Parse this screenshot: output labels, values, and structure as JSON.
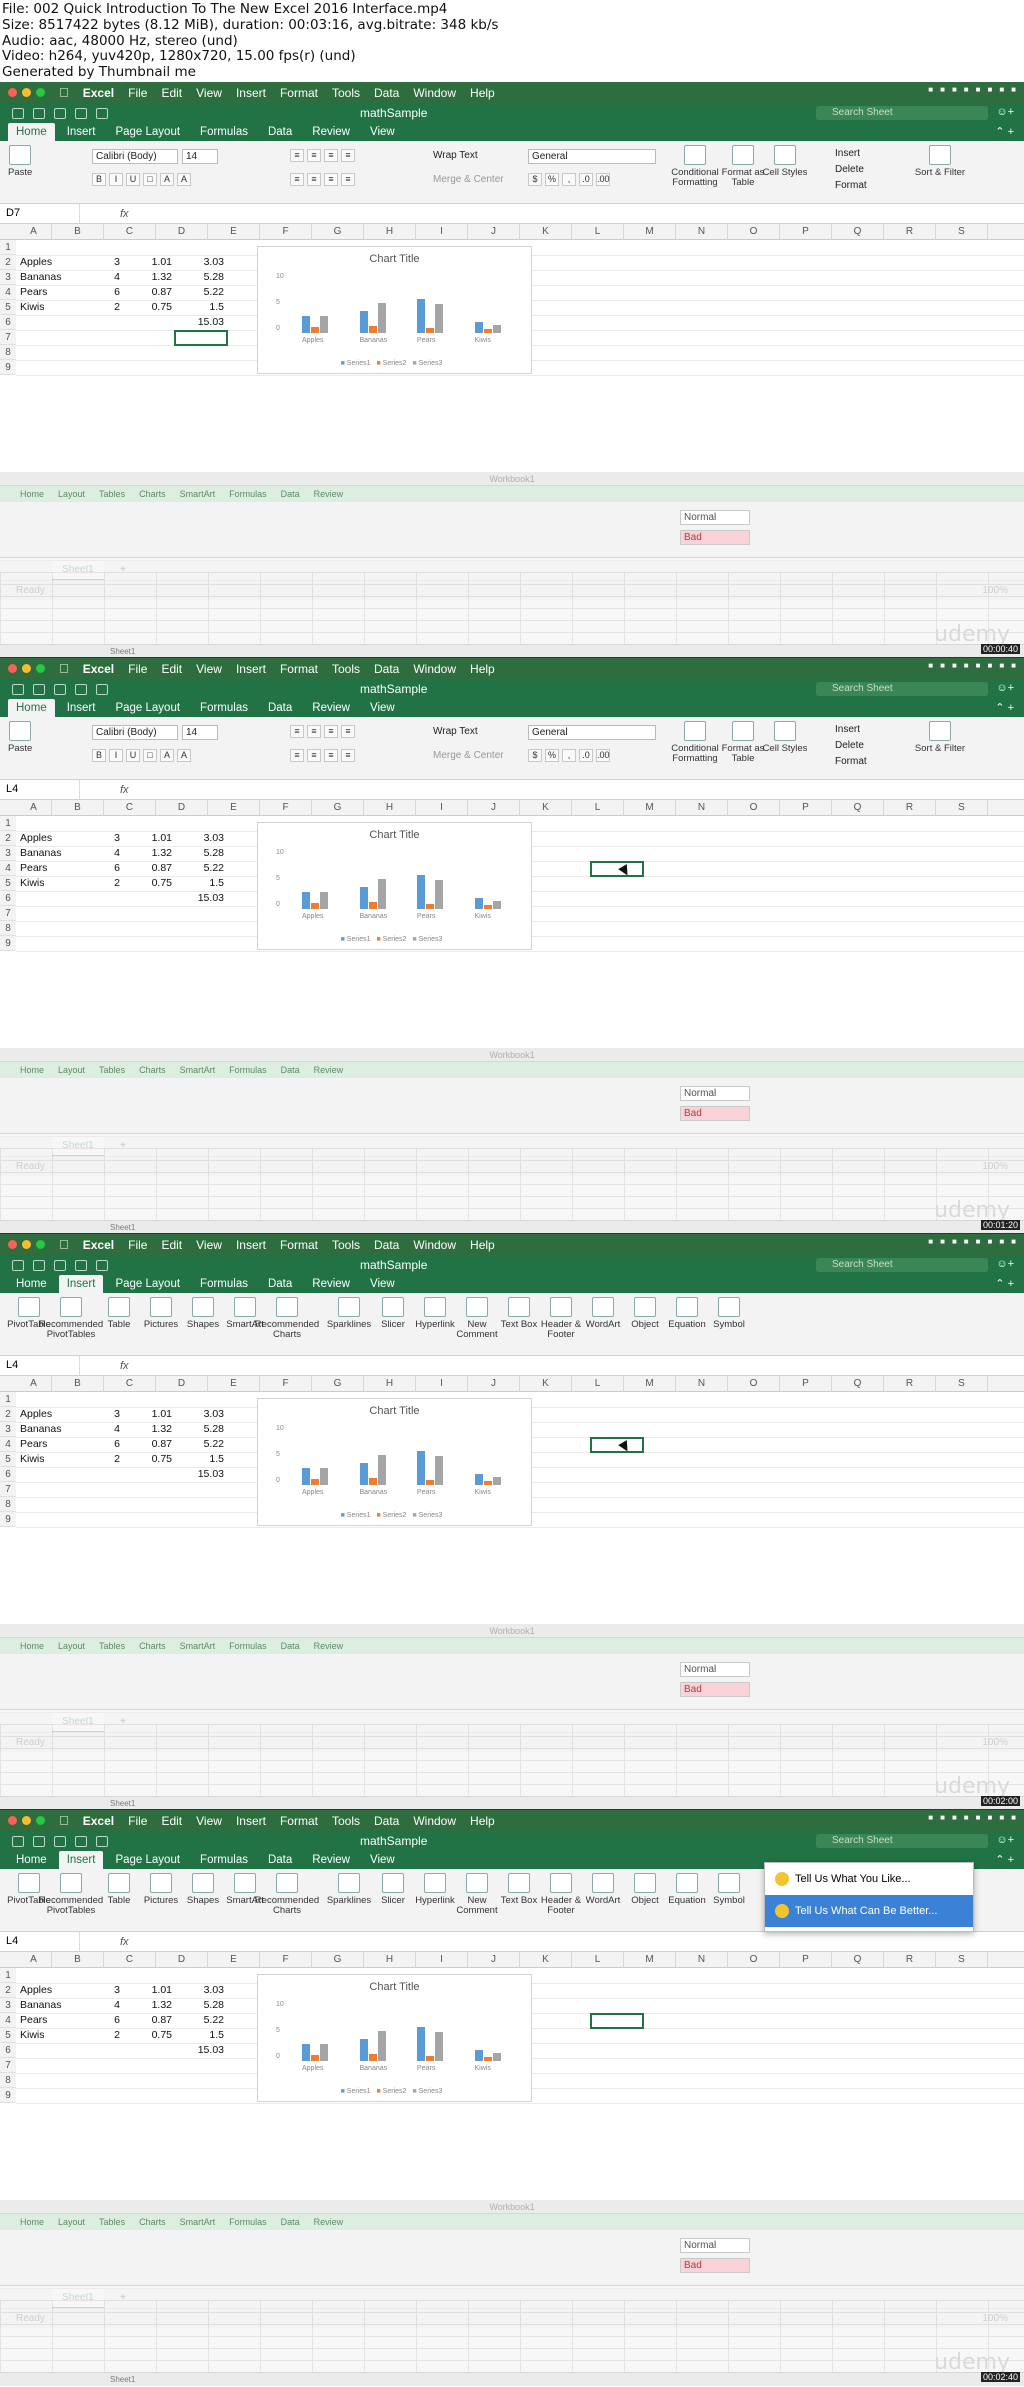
{
  "header": {
    "lines": [
      "File: 002 Quick Introduction To The New Excel 2016 Interface.mp4",
      "Size: 8517422 bytes (8.12 MiB), duration: 00:03:16, avg.bitrate: 348 kb/s",
      "Audio: aac, 48000 Hz, stereo (und)",
      "Video: h264, yuv420p, 1280x720, 15.00 fps(r) (und)",
      "Generated by Thumbnail me"
    ]
  },
  "menubar": {
    "app": "Excel",
    "items": [
      "File",
      "Edit",
      "View",
      "Insert",
      "Format",
      "Tools",
      "Data",
      "Window",
      "Help"
    ]
  },
  "doc_title": "mathSample",
  "search_placeholder": "Search Sheet",
  "tabs": [
    "Home",
    "Insert",
    "Page Layout",
    "Formulas",
    "Data",
    "Review",
    "View"
  ],
  "home_ribbon": {
    "paste": "Paste",
    "font": "Calibri (Body)",
    "size": "14",
    "wrap": "Wrap Text",
    "merge": "Merge & Center",
    "number_format": "General",
    "cond": "Conditional Formatting",
    "fmt_table": "Format as Table",
    "cell_styles": "Cell Styles",
    "insert": "Insert",
    "delete": "Delete",
    "format": "Format",
    "sort": "Sort & Filter"
  },
  "insert_ribbon": {
    "items": [
      "PivotTable",
      "Recommended PivotTables",
      "Table",
      "Pictures",
      "Shapes",
      "SmartArt",
      "Recommended Charts",
      "Sparklines",
      "Slicer",
      "Hyperlink",
      "New Comment",
      "Text Box",
      "Header & Footer",
      "WordArt",
      "Object",
      "Equation",
      "Symbol"
    ]
  },
  "columns": [
    "A",
    "B",
    "C",
    "D",
    "E",
    "F",
    "G",
    "H",
    "I",
    "J",
    "K",
    "L",
    "M",
    "N",
    "O",
    "P",
    "Q",
    "R",
    "S"
  ],
  "rows": [
    "1",
    "2",
    "3",
    "4",
    "5",
    "6",
    "7",
    "8",
    "9"
  ],
  "sheet_data": [
    {
      "a": "Apples",
      "b": "3",
      "c": "1.01",
      "d": "3.03"
    },
    {
      "a": "Bananas",
      "b": "4",
      "c": "1.32",
      "d": "5.28"
    },
    {
      "a": "Pears",
      "b": "6",
      "c": "0.87",
      "d": "5.22"
    },
    {
      "a": "Kiwis",
      "b": "2",
      "c": "0.75",
      "d": "1.5"
    },
    {
      "a": "",
      "b": "",
      "c": "",
      "d": "15.03"
    }
  ],
  "chart_data": {
    "type": "bar",
    "title": "Chart Title",
    "categories": [
      "Apples",
      "Bananas",
      "Pears",
      "Kiwis"
    ],
    "series": [
      {
        "name": "Series1",
        "values": [
          3,
          4,
          6,
          2
        ],
        "color": "#5b9bd5"
      },
      {
        "name": "Series2",
        "values": [
          1.01,
          1.32,
          0.87,
          0.75
        ],
        "color": "#ed7d31"
      },
      {
        "name": "Series3",
        "values": [
          3.03,
          5.28,
          5.22,
          1.5
        ],
        "color": "#a5a5a5"
      }
    ],
    "ylim": [
      0,
      10
    ],
    "yticks": [
      "10",
      "5",
      "0"
    ]
  },
  "sheet_tab": "Sheet1",
  "status": {
    "ready": "Ready",
    "zoom": "100%"
  },
  "ghost": {
    "title": "Workbook1",
    "tabs": [
      "Home",
      "Layout",
      "Tables",
      "Charts",
      "SmartArt",
      "Formulas",
      "Data",
      "Review"
    ],
    "style_normal": "Normal",
    "style_bad": "Bad"
  },
  "frames": [
    {
      "namebox": "D7",
      "tab": "Home",
      "timestamp": "00:00:40",
      "popup": false
    },
    {
      "namebox": "L4",
      "tab": "Home",
      "timestamp": "00:01:20",
      "popup": false
    },
    {
      "namebox": "L4",
      "tab": "Insert",
      "timestamp": "00:02:00",
      "popup": false
    },
    {
      "namebox": "L4",
      "tab": "Insert",
      "timestamp": "00:02:40",
      "popup": true
    }
  ],
  "popup": {
    "items": [
      "Tell Us What You Like...",
      "Tell Us What Can Be Better..."
    ]
  },
  "watermark": "udemy",
  "colors": {
    "excel_green": "#217346",
    "menubar_green": "#2e6e3e",
    "selection": "#217346"
  }
}
